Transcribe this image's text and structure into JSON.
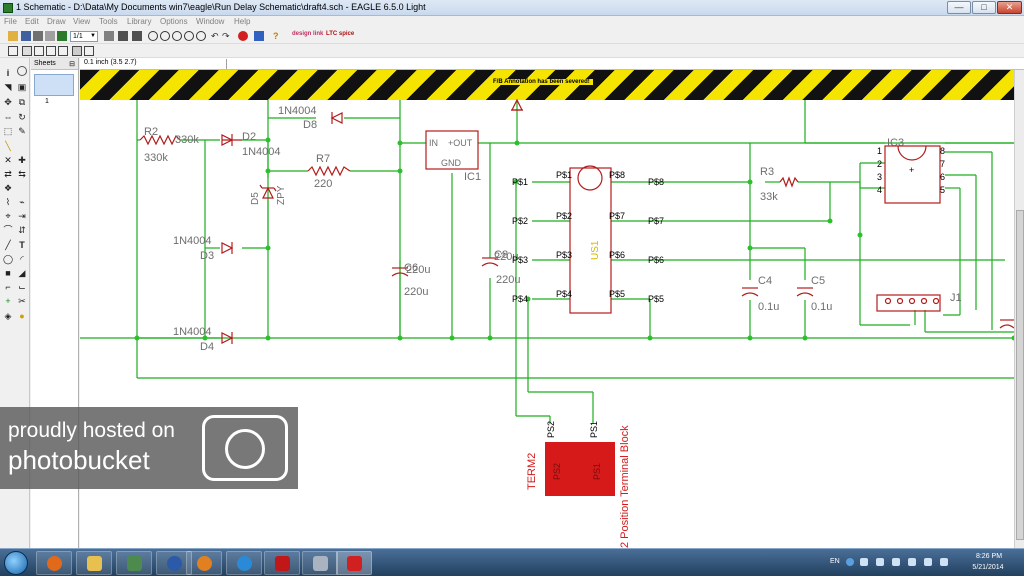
{
  "window": {
    "title": "1 Schematic - D:\\Data\\My Documents win7\\eagle\\Run Delay Schematic\\draft4.sch - EAGLE 6.5.0 Light",
    "minimize": "—",
    "maximize": "□",
    "close": "✕"
  },
  "menu": [
    "File",
    "Edit",
    "Draw",
    "View",
    "Tools",
    "Library",
    "Options",
    "Window",
    "Help"
  ],
  "toolbar": {
    "zoom_select": "1/1",
    "brand1": "design link",
    "brand2": "LTC spice"
  },
  "sheets": {
    "title": "Sheets",
    "pin": "⊟",
    "sheet_number": "1"
  },
  "coordinates": "0.1 inch (3.5 2.7)",
  "warning": "F/B Annotation has been severed!",
  "schematic": {
    "parts": {
      "r2_name": "R2",
      "r2_value": "330k",
      "r2_value2": "330k",
      "d2_name": "D2",
      "d2_value": "1N4004",
      "d8_value": "1N4004",
      "d8_name": "D8",
      "r7_name": "R7",
      "r7_value": "220",
      "d5_name": "D5",
      "d5_value": "ZPY",
      "d3_value": "1N4004",
      "d3_name": "D3",
      "d4_value": "1N4004",
      "d4_name": "D4",
      "ic1_in": "IN",
      "ic1_out": "+OUT",
      "ic1_gnd": "GND",
      "ic1_name": "IC1",
      "c6_name": "C6",
      "c6_value": "220u",
      "c6_value2": "220u",
      "c8_name": "C8",
      "c8_value": "220u",
      "c8_value2": "220u",
      "us1_name": "US1",
      "r3_name": "R3",
      "r3_value": "33k",
      "c4_name": "C4",
      "c4_value": "0.1u",
      "c5_name": "C5",
      "c5_value": "0.1u",
      "ic3_name": "IC3",
      "j1_name": "J1",
      "term2_name": "TERM2",
      "term2_value": "2 Position Terminal Block",
      "term2_ps1": "PS1",
      "term2_ps2": "PS2"
    },
    "us1_pins_left": [
      "P$1",
      "P$2",
      "P$3",
      "P$4"
    ],
    "us1_pins_right": [
      "P$8",
      "P$7",
      "P$6",
      "P$5"
    ],
    "net_left": [
      "P$1",
      "P$2",
      "P$3",
      "P$4"
    ],
    "net_right": [
      "P$8",
      "P$7",
      "P$6",
      "P$5"
    ],
    "ic3_pins_left": [
      "1",
      "2",
      "3",
      "4"
    ],
    "ic3_pins_right": [
      "8",
      "7",
      "6",
      "5"
    ],
    "ic3_plus": "+",
    "colors": {
      "wire": "#1fae1f",
      "part": "#b31b1b",
      "label": "#6e6e6e",
      "junction": "#2dc02d",
      "highlight": "#d01c1c",
      "us1_label": "#d4b800"
    }
  },
  "watermark": {
    "line1": "proudly hosted on",
    "line2": "photobucket"
  },
  "taskbar": {
    "lang": "EN",
    "time": "8:26 PM",
    "date": "5/21/2014"
  }
}
